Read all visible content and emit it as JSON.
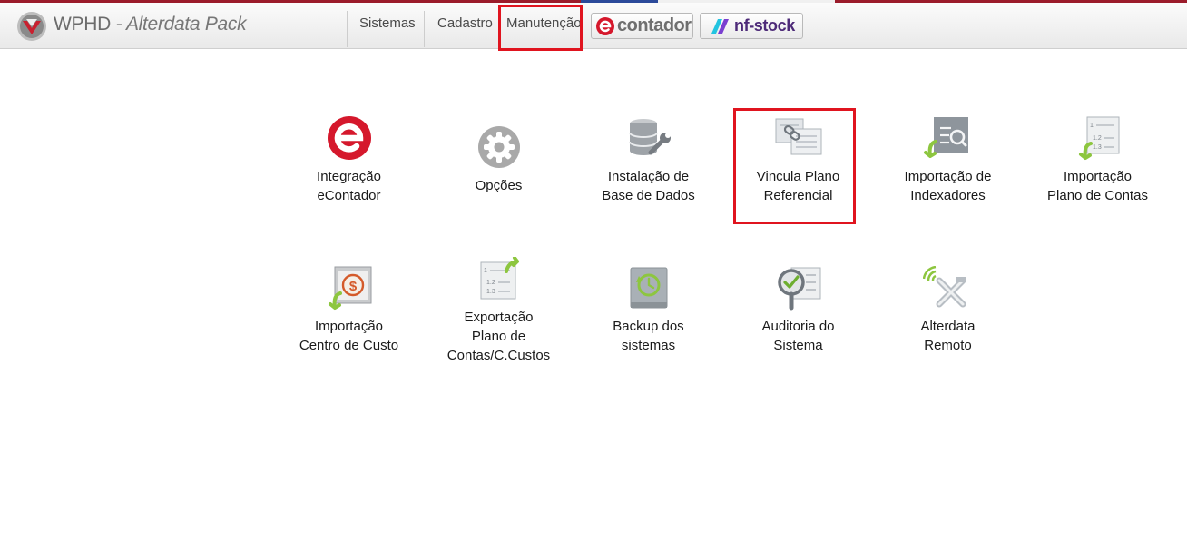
{
  "app": {
    "title_main": "WPHD",
    "title_sub": " - Alterdata Pack"
  },
  "menu": {
    "items": [
      {
        "label": "Sistemas"
      },
      {
        "label": "Cadastro"
      },
      {
        "label": "Manutenção",
        "highlighted": true
      }
    ],
    "brand_buttons": [
      {
        "label": "contador",
        "icon": "econtador-logo-icon"
      },
      {
        "label": "nf-stock",
        "icon": "nfstock-logo-icon"
      }
    ]
  },
  "tiles": [
    {
      "label_line1": "Integração",
      "label_line2": "eContador",
      "icon": "econtador-icon",
      "accelerator": "e"
    },
    {
      "label_line1": "Opções",
      "label_line2": "",
      "icon": "gear-icon",
      "accelerator": "O"
    },
    {
      "label_line1": "Instalação de",
      "label_line2": "Base de Dados",
      "icon": "database-wrench-icon",
      "accelerator": "I"
    },
    {
      "label_line1": "Vincula Plano",
      "label_line2": "Referencial",
      "icon": "linked-documents-icon",
      "accelerator": "f",
      "highlighted": true
    },
    {
      "label_line1": "Importação de",
      "label_line2": "Indexadores",
      "icon": "search-document-import-icon",
      "accelerator": "I"
    },
    {
      "label_line1": "Importação",
      "label_line2": "Plano de Contas",
      "icon": "list-import-icon",
      "accelerator": "m"
    },
    {
      "label_line1": "Importação",
      "label_line2": "Centro de Custo",
      "icon": "dollar-import-icon",
      "accelerator": "n"
    },
    {
      "label_line1": "Exportação",
      "label_line2": "Plano de",
      "label_line3": "Contas/C.Custos",
      "icon": "list-export-icon",
      "accelerator": "x"
    },
    {
      "label_line1": "Backup dos",
      "label_line2": "sistemas",
      "icon": "backup-clock-icon",
      "accelerator": "B"
    },
    {
      "label_line1": "Auditoria do",
      "label_line2": "Sistema",
      "icon": "audit-magnifier-icon",
      "accelerator": "A"
    },
    {
      "label_line1": "Alterdata",
      "label_line2": "Remoto",
      "icon": "remote-access-icon",
      "accelerator": "e"
    }
  ],
  "colors": {
    "accent_red": "#d5182c",
    "highlight_box": "#e0141f",
    "import_arrow_green": "#8dc63f",
    "nfstock_purple": "#4d2a78"
  }
}
